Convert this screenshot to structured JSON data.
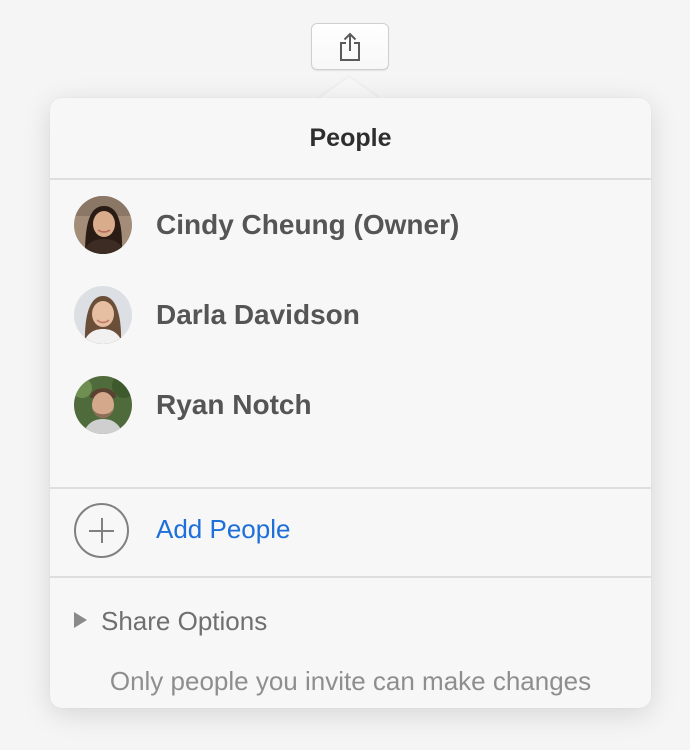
{
  "toolbar": {
    "share_icon": "share-icon"
  },
  "popover": {
    "title": "People",
    "people": [
      {
        "name": "Cindy Cheung (Owner)",
        "avatar": "avatar-photo"
      },
      {
        "name": "Darla Davidson",
        "avatar": "avatar-photo"
      },
      {
        "name": "Ryan Notch",
        "avatar": "avatar-photo"
      }
    ],
    "add_people": {
      "icon": "plus-circle-icon",
      "label": "Add People"
    },
    "share_options": {
      "icon": "disclosure-triangle-icon",
      "label": "Share Options",
      "description": "Only people you invite can make changes"
    }
  },
  "colors": {
    "link": "#1e6fd9",
    "background": "#f5f5f5",
    "panel": "#f7f7f7",
    "divider": "#dedede"
  }
}
